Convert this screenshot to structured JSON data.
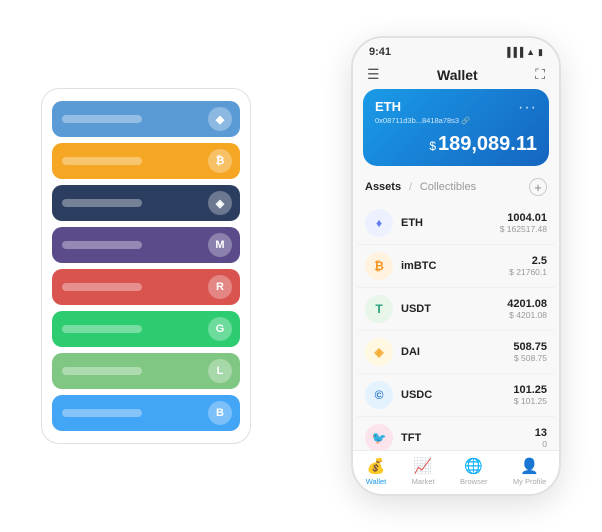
{
  "status_bar": {
    "time": "9:41",
    "signal": "●●●",
    "wifi": "WiFi",
    "battery": "🔋"
  },
  "header": {
    "menu_icon": "☰",
    "title": "Wallet",
    "scan_icon": "⛶"
  },
  "eth_card": {
    "coin": "ETH",
    "address": "0x08711d3b...8418a78s3  🔗",
    "balance_symbol": "$",
    "balance": "189,089.11",
    "more": "···"
  },
  "assets_section": {
    "active_tab": "Assets",
    "separator": "/",
    "inactive_tab": "Collectibles",
    "add_icon": "+"
  },
  "assets": [
    {
      "symbol": "ETH",
      "icon": "♦",
      "icon_color": "#627eea",
      "bg": "eth-bg",
      "amount": "1004.01",
      "usd": "$ 162517.48"
    },
    {
      "symbol": "imBTC",
      "icon": "₿",
      "icon_color": "#f7931a",
      "bg": "imbtc-bg",
      "amount": "2.5",
      "usd": "$ 21760.1"
    },
    {
      "symbol": "USDT",
      "icon": "T",
      "icon_color": "#26a17b",
      "bg": "usdt-bg",
      "amount": "4201.08",
      "usd": "$ 4201.08"
    },
    {
      "symbol": "DAI",
      "icon": "◈",
      "icon_color": "#f5ac37",
      "bg": "dai-bg",
      "amount": "508.75",
      "usd": "$ 508.75"
    },
    {
      "symbol": "USDC",
      "icon": "©",
      "icon_color": "#2775ca",
      "bg": "usdc-bg",
      "amount": "101.25",
      "usd": "$ 101.25"
    },
    {
      "symbol": "TFT",
      "icon": "🐦",
      "icon_color": "#e0245e",
      "bg": "tft-bg",
      "amount": "13",
      "usd": "0"
    }
  ],
  "bottom_nav": [
    {
      "id": "wallet",
      "label": "Wallet",
      "icon": "💰",
      "active": true
    },
    {
      "id": "market",
      "label": "Market",
      "icon": "📈",
      "active": false
    },
    {
      "id": "browser",
      "label": "Browser",
      "icon": "🌐",
      "active": false
    },
    {
      "id": "profile",
      "label": "My Profile",
      "icon": "👤",
      "active": false
    }
  ],
  "card_stack": [
    {
      "color": "#5b9bd5",
      "icon": "◆"
    },
    {
      "color": "#f5a623",
      "icon": "₿"
    },
    {
      "color": "#2c3e60",
      "icon": "◈"
    },
    {
      "color": "#5b4b8a",
      "icon": "M"
    },
    {
      "color": "#d9534f",
      "icon": "R"
    },
    {
      "color": "#2ecc71",
      "icon": "G"
    },
    {
      "color": "#81c784",
      "icon": "L"
    },
    {
      "color": "#42a5f5",
      "icon": "B"
    }
  ]
}
